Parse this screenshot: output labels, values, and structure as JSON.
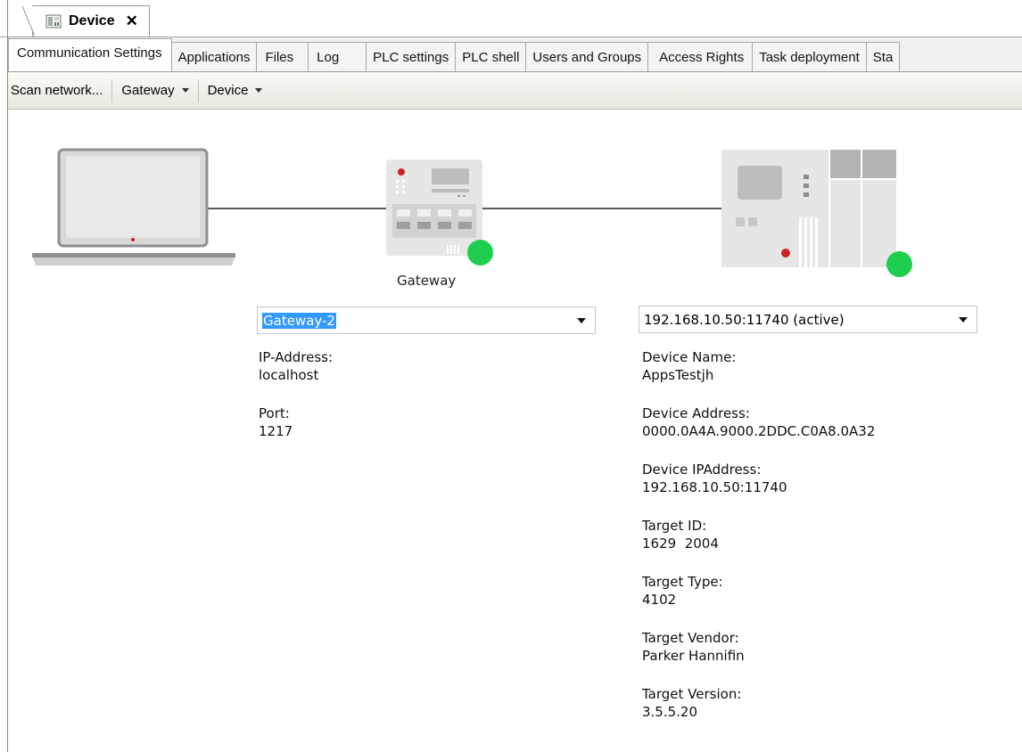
{
  "document_tab": {
    "title": "Device",
    "close_glyph": "✕"
  },
  "tabs": [
    "Communication Settings",
    "Applications",
    "Files",
    "Log",
    "PLC settings",
    "PLC shell",
    "Users and Groups",
    "Access Rights",
    "Task deployment",
    "Sta"
  ],
  "active_tab": "Communication Settings",
  "toolbar": {
    "scan_network": "Scan network...",
    "gateway": "Gateway",
    "device": "Device"
  },
  "diagram": {
    "gateway_label": "Gateway",
    "status_color": "#1fce4f"
  },
  "gateway": {
    "selected": "Gateway-2",
    "fields": [
      {
        "label": "IP-Address:",
        "value": "localhost"
      },
      {
        "label": "Port:",
        "value": "1217"
      }
    ]
  },
  "device": {
    "selected": "192.168.10.50:11740 (active)",
    "fields": [
      {
        "label": "Device Name:",
        "value": "AppsTestjh"
      },
      {
        "label": "Device Address:",
        "value": "0000.0A4A.9000.2DDC.C0A8.0A32"
      },
      {
        "label": "Device IPAddress:",
        "value": "192.168.10.50:11740"
      },
      {
        "label": "Target ID:",
        "value": "1629  2004"
      },
      {
        "label": "Target Type:",
        "value": "4102"
      },
      {
        "label": "Target Vendor:",
        "value": "Parker Hannifin"
      },
      {
        "label": "Target Version:",
        "value": "3.5.5.20"
      }
    ]
  }
}
